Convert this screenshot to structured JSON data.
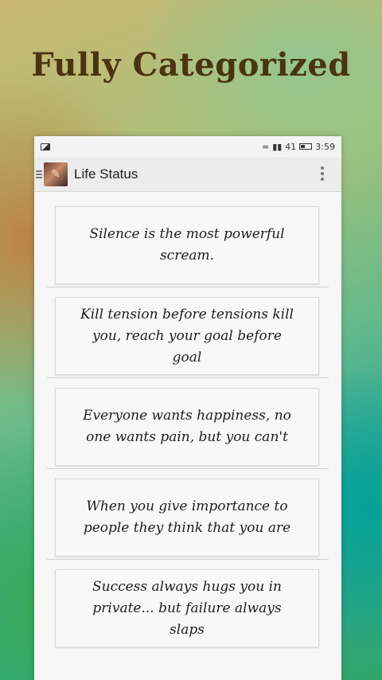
{
  "headline": "Fully Categorized",
  "status_bar": {
    "signal_text": "•ııl .ııl",
    "battery_level": "41",
    "time": "3:59"
  },
  "app_bar": {
    "title": "Life Status"
  },
  "quotes": [
    "Silence is the most powerful scream.",
    "Kill tension before tensions kill you, reach your goal before goal",
    "Everyone wants happiness, no one wants pain, but you can't",
    "When you give importance to people they think that you are",
    "Success always hugs you in private... but failure always slaps"
  ],
  "colors": {
    "headline": "#4a3410",
    "card_background": "#f8f8f8",
    "app_bar_background": "#ececec"
  }
}
